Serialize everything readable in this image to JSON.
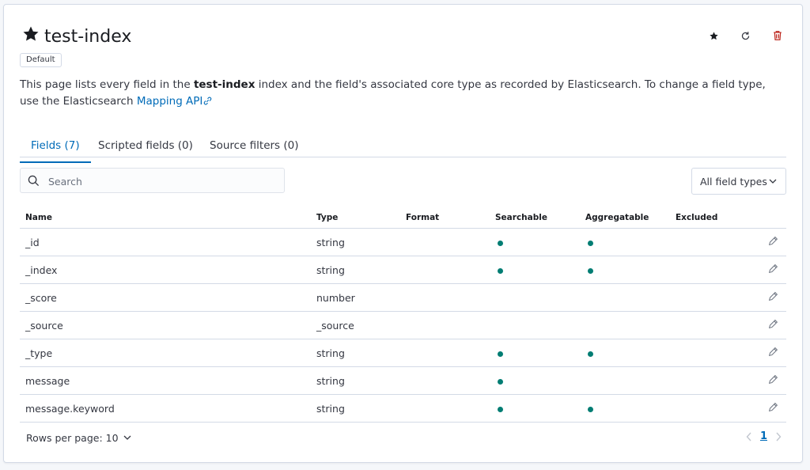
{
  "header": {
    "title": "test-index",
    "badge": "Default",
    "icons": [
      "star-filled-icon",
      "refresh-icon",
      "trash-icon"
    ],
    "colors": {
      "danger": "#bd271e",
      "primary": "#006bb8"
    }
  },
  "description": {
    "part1": "This page lists every field in the ",
    "index_name": "test-index",
    "part2": " index and the field's associated core type as recorded by Elasticsearch. To change a field type, use the Elasticsearch ",
    "link": "Mapping API"
  },
  "tabs": [
    {
      "label": "Fields (7)",
      "active": true
    },
    {
      "label": "Scripted fields (0)",
      "active": false
    },
    {
      "label": "Source filters (0)",
      "active": false
    }
  ],
  "search": {
    "placeholder": "Search"
  },
  "type_filter": {
    "label": "All field types"
  },
  "table": {
    "columns": [
      "Name",
      "Type",
      "Format",
      "Searchable",
      "Aggregatable",
      "Excluded"
    ],
    "rows": [
      {
        "name": "_id",
        "type": "string",
        "searchable": true,
        "aggregatable": true
      },
      {
        "name": "_index",
        "type": "string",
        "searchable": true,
        "aggregatable": true
      },
      {
        "name": "_score",
        "type": "number",
        "searchable": false,
        "aggregatable": false
      },
      {
        "name": "_source",
        "type": "_source",
        "searchable": false,
        "aggregatable": false
      },
      {
        "name": "_type",
        "type": "string",
        "searchable": true,
        "aggregatable": true
      },
      {
        "name": "message",
        "type": "string",
        "searchable": true,
        "aggregatable": false
      },
      {
        "name": "message.keyword",
        "type": "string",
        "searchable": true,
        "aggregatable": true
      }
    ],
    "status_color": "#017d73"
  },
  "footer": {
    "rows_per_page": "Rows per page: 10",
    "current_page": "1"
  }
}
